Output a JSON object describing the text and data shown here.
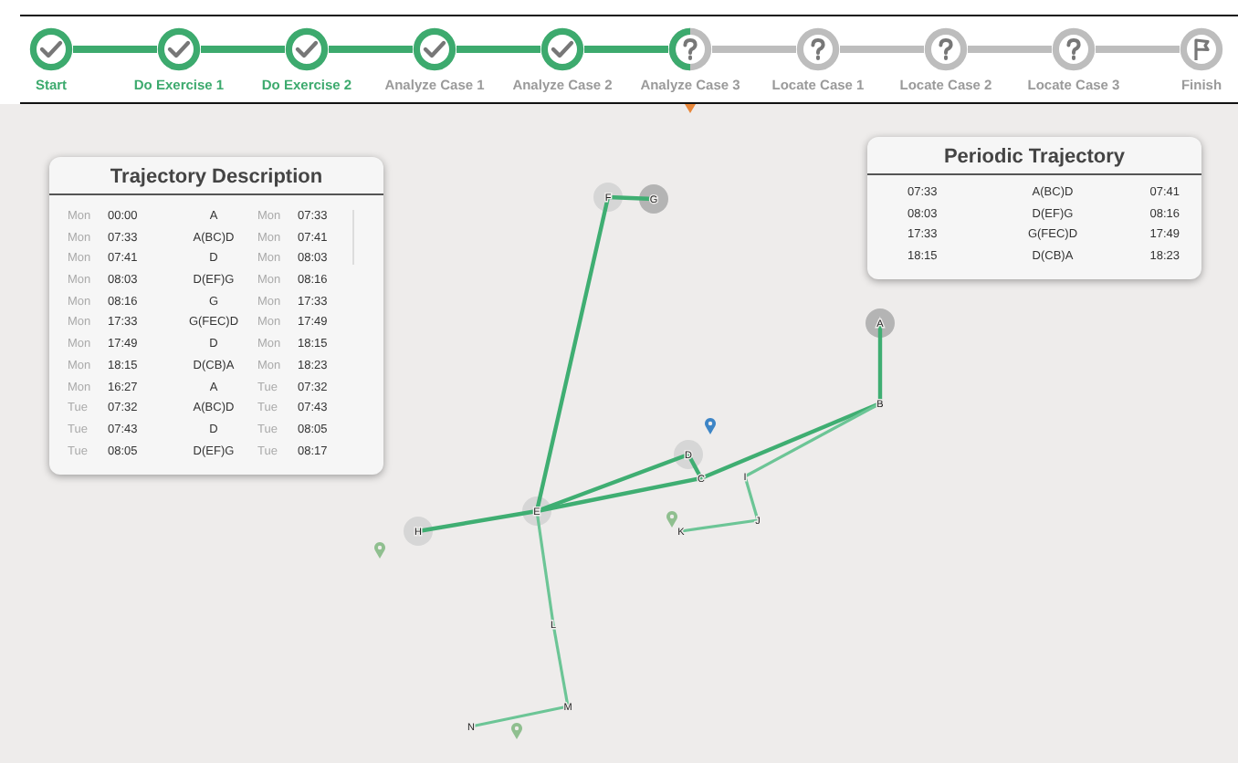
{
  "steps": [
    {
      "label": "Start",
      "kind": "done",
      "highlighted": true
    },
    {
      "label": "Do Exercise 1",
      "kind": "done",
      "highlighted": true
    },
    {
      "label": "Do Exercise 2",
      "kind": "done",
      "highlighted": true
    },
    {
      "label": "Analyze Case 1",
      "kind": "done",
      "highlighted": false
    },
    {
      "label": "Analyze Case 2",
      "kind": "done",
      "highlighted": false
    },
    {
      "label": "Analyze Case 3",
      "kind": "current",
      "highlighted": false
    },
    {
      "label": "Locate Case 1",
      "kind": "todo",
      "highlighted": false
    },
    {
      "label": "Locate Case 2",
      "kind": "todo",
      "highlighted": false
    },
    {
      "label": "Locate Case 3",
      "kind": "todo",
      "highlighted": false
    },
    {
      "label": "Finish",
      "kind": "todo",
      "highlighted": false
    }
  ],
  "description": {
    "title": "Trajectory Description",
    "rows": [
      {
        "start_day": "Mon",
        "start_time": "00:00",
        "route": "A",
        "end_day": "Mon",
        "end_time": "07:33"
      },
      {
        "start_day": "Mon",
        "start_time": "07:33",
        "route": "A(BC)D",
        "end_day": "Mon",
        "end_time": "07:41"
      },
      {
        "start_day": "Mon",
        "start_time": "07:41",
        "route": "D",
        "end_day": "Mon",
        "end_time": "08:03"
      },
      {
        "start_day": "Mon",
        "start_time": "08:03",
        "route": "D(EF)G",
        "end_day": "Mon",
        "end_time": "08:16"
      },
      {
        "start_day": "Mon",
        "start_time": "08:16",
        "route": "G",
        "end_day": "Mon",
        "end_time": "17:33"
      },
      {
        "start_day": "Mon",
        "start_time": "17:33",
        "route": "G(FEC)D",
        "end_day": "Mon",
        "end_time": "17:49"
      },
      {
        "start_day": "Mon",
        "start_time": "17:49",
        "route": "D",
        "end_day": "Mon",
        "end_time": "18:15"
      },
      {
        "start_day": "Mon",
        "start_time": "18:15",
        "route": "D(CB)A",
        "end_day": "Mon",
        "end_time": "18:23"
      },
      {
        "start_day": "Mon",
        "start_time": "16:27",
        "route": "A",
        "end_day": "Tue",
        "end_time": "07:32"
      },
      {
        "start_day": "Tue",
        "start_time": "07:32",
        "route": "A(BC)D",
        "end_day": "Tue",
        "end_time": "07:43"
      },
      {
        "start_day": "Tue",
        "start_time": "07:43",
        "route": "D",
        "end_day": "Tue",
        "end_time": "08:05"
      },
      {
        "start_day": "Tue",
        "start_time": "08:05",
        "route": "D(EF)G",
        "end_day": "Tue",
        "end_time": "08:17"
      }
    ]
  },
  "periodic": {
    "title": "Periodic Trajectory",
    "rows": [
      {
        "start_time": "07:33",
        "route": "A(BC)D",
        "end_time": "07:41"
      },
      {
        "start_time": "08:03",
        "route": "D(EF)G",
        "end_time": "08:16"
      },
      {
        "start_time": "17:33",
        "route": "G(FEC)D",
        "end_time": "17:49"
      },
      {
        "start_time": "18:15",
        "route": "D(CB)A",
        "end_time": "18:23"
      }
    ]
  },
  "map": {
    "nodes": [
      {
        "label": "F",
        "kind": "light"
      },
      {
        "label": "G",
        "kind": "dark"
      },
      {
        "label": "A",
        "kind": "dark"
      },
      {
        "label": "B",
        "kind": "plain"
      },
      {
        "label": "D",
        "kind": "light"
      },
      {
        "label": "C",
        "kind": "plain"
      },
      {
        "label": "E",
        "kind": "light"
      },
      {
        "label": "H",
        "kind": "light"
      },
      {
        "label": "I",
        "kind": "plain"
      },
      {
        "label": "J",
        "kind": "plain"
      },
      {
        "label": "K",
        "kind": "plain"
      },
      {
        "label": "L",
        "kind": "plain"
      },
      {
        "label": "M",
        "kind": "plain"
      },
      {
        "label": "N",
        "kind": "plain"
      }
    ],
    "pins": [
      {
        "color": "#3d85c6"
      },
      {
        "color": "#8fbf8f"
      },
      {
        "color": "#8fbf8f"
      },
      {
        "color": "#8fbf8f"
      }
    ]
  }
}
